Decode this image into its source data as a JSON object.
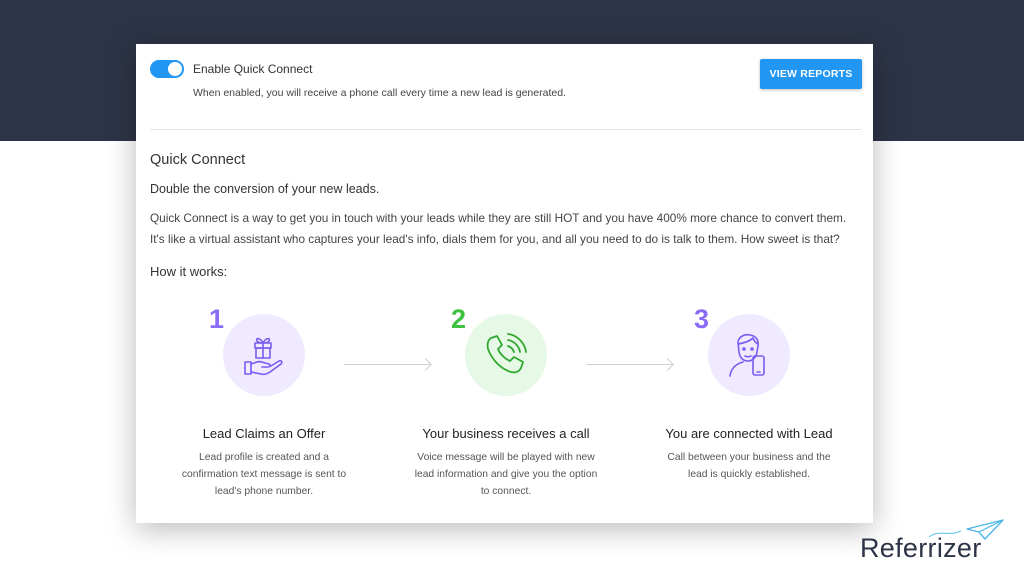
{
  "quick_connect_toggle": {
    "label": "Enable Quick Connect",
    "description": "When enabled, you will receive a phone call every time a new lead is generated.",
    "enabled": true
  },
  "header": {
    "view_reports_label": "VIEW REPORTS"
  },
  "content": {
    "title": "Quick Connect",
    "tagline": "Double the conversion of your new leads.",
    "description": "Quick Connect is a way to get you in touch with your leads while they are still HOT and you have 400% more chance to convert them. It's like a virtual assistant who captures your lead's info, dials them for you, and all you need to do is talk to them. How sweet is that?",
    "how_it_works": "How it works:"
  },
  "steps": [
    {
      "number": "1",
      "icon": "gift-hand-icon",
      "title": "Lead Claims an Offer",
      "text": "Lead profile is created and a confirmation text message is sent to lead's phone number.",
      "color": "#8b6cf5",
      "bg": "#efeaff"
    },
    {
      "number": "2",
      "icon": "phone-call-icon",
      "title": "Your business receives a call",
      "text": "Voice message will be played with new lead information and give you the option to connect.",
      "color": "#3ec23e",
      "bg": "#e6f8e6"
    },
    {
      "number": "3",
      "icon": "person-phone-icon",
      "title": "You are connected with Lead",
      "text": "Call between your business and the lead is quickly established.",
      "color": "#8b6cf5",
      "bg": "#efeaff"
    }
  ],
  "colors": {
    "header_bg": "#2d3447",
    "accent": "#2196f3"
  },
  "brand": {
    "logo_text": "Referrizer",
    "icon": "paper-plane-icon"
  }
}
